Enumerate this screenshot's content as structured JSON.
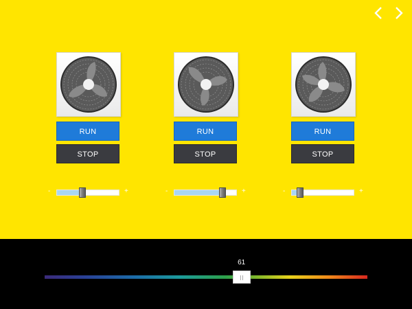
{
  "nav": {
    "prev_icon": "chevron-left-icon",
    "next_icon": "chevron-right-icon"
  },
  "colors": {
    "background": "#ffe500",
    "run": "#1f7bd9",
    "stop": "#3a3b40",
    "slider_fill": "#a9d6f2",
    "bottom_bar": "#000000"
  },
  "units": [
    {
      "run_label": "RUN",
      "stop_label": "STOP",
      "minus": "-",
      "plus": "+",
      "speed": 0.41
    },
    {
      "run_label": "RUN",
      "stop_label": "STOP",
      "minus": "-",
      "plus": "+",
      "speed": 0.78
    },
    {
      "run_label": "RUN",
      "stop_label": "STOP",
      "minus": "-",
      "plus": "+",
      "speed": 0.13
    }
  ],
  "temperature": {
    "value": "61",
    "level": 0.61
  }
}
